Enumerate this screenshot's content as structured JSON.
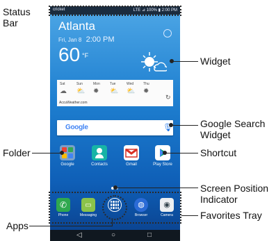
{
  "labels": {
    "status_bar": "Status\nBar",
    "widget": "Widget",
    "google_search": "Google Search\nWidget",
    "folder": "Folder",
    "shortcut": "Shortcut",
    "screen_position": "Screen Position\nIndicator",
    "favorites_tray": "Favorites Tray",
    "apps": "Apps"
  },
  "phone": {
    "status": {
      "carrier": "cricket",
      "icons": "LTE ⊿ 100% ▮ 2:00 PM"
    },
    "weather": {
      "city": "Atlanta",
      "date": "Fri, Jan 8",
      "time": "2:00 PM",
      "temp": "60",
      "unit": "°F",
      "days": [
        "Sat",
        "Sun",
        "Mon",
        "Tue",
        "Wed",
        "Thu"
      ],
      "provider": "AccuWeather.com"
    },
    "search": {
      "logo": "Google"
    },
    "home_apps": [
      "Google",
      "Contacts",
      "Gmail",
      "Play Store"
    ],
    "tray_apps": [
      "Phone",
      "Messaging",
      "",
      "Browser",
      "Camera"
    ]
  },
  "colors": {
    "accent": "#1e7fd0",
    "tray_border": "#2a2a2a"
  }
}
